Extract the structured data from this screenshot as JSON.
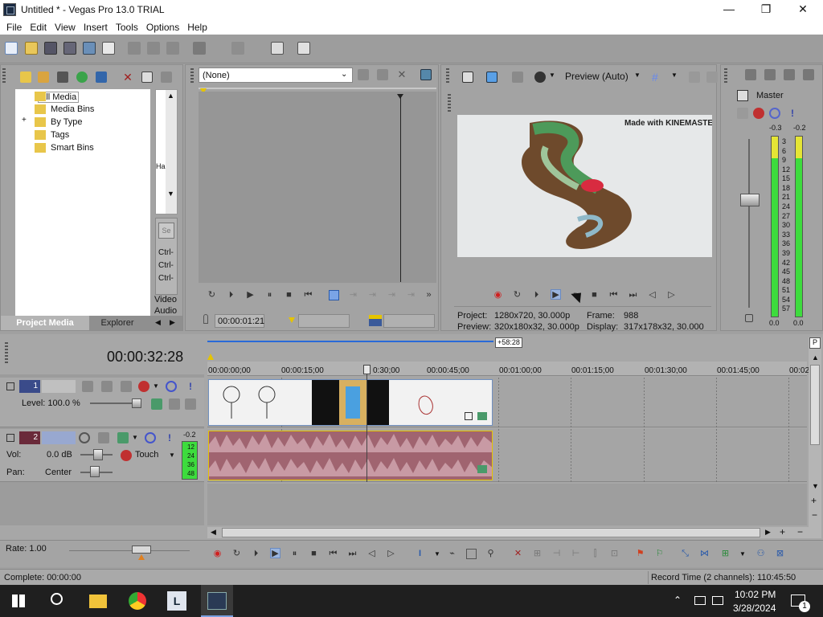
{
  "window": {
    "title": "Untitled * - Vegas Pro 13.0 TRIAL",
    "minimize": "—",
    "maximize": "❐",
    "close": "✕"
  },
  "menu": [
    "File",
    "Edit",
    "View",
    "Insert",
    "Tools",
    "Options",
    "Help"
  ],
  "media": {
    "tree": [
      "All Media",
      "Media Bins",
      "By Type",
      "Tags",
      "Smart Bins"
    ],
    "expander": "+",
    "side_labels": [
      "Ctrl-",
      "Ctrl-",
      "Ctrl-"
    ],
    "side_top": "Se",
    "ha": "Ha",
    "video_label": "Video",
    "audio_label": "Audio",
    "tabs": [
      "Project Media",
      "Explorer"
    ]
  },
  "trimmer": {
    "dropdown": "(None)",
    "timecode": "00:00:01:21"
  },
  "preview": {
    "mode": "Preview (Auto)",
    "watermark": "Made with KINEMASTER",
    "project_label": "Project:",
    "project_value": "1280x720, 30.000p",
    "frame_label": "Frame:",
    "frame_value": "988",
    "preview_label": "Preview:",
    "preview_value": "320x180x32, 30.000p",
    "display_label": "Display:",
    "display_value": "317x178x32, 30.000"
  },
  "master": {
    "label": "Master",
    "peak_left": "-0.3",
    "peak_right": "-0.2",
    "scale": [
      "3",
      "6",
      "9",
      "12",
      "15",
      "18",
      "21",
      "24",
      "27",
      "30",
      "33",
      "36",
      "39",
      "42",
      "45",
      "48",
      "51",
      "54",
      "57"
    ],
    "bottom_left": "0.0",
    "bottom_right": "0.0"
  },
  "timeline": {
    "time": "00:00:32:28",
    "region": "+58:28",
    "ruler": [
      "00:00:00;00",
      "00:00:15;00",
      "00:00:30;00",
      "00:00:45;00",
      "00:01:00;00",
      "00:01:15;00",
      "00:01:30;00",
      "00:01:45;00",
      "00:02"
    ],
    "ruler_cursor_label": "0:30;00"
  },
  "tracks": {
    "video": {
      "num": "1",
      "level": "Level: 100.0 %"
    },
    "audio": {
      "num": "2",
      "vol_label": "Vol:",
      "vol_value": "0.0 dB",
      "pan_label": "Pan:",
      "pan_value": "Center",
      "touch": "Touch",
      "meter_top": "-0.2",
      "meter": [
        "12",
        "24",
        "36",
        "48"
      ]
    }
  },
  "transport": {
    "rate": "Rate: 1.00"
  },
  "status": {
    "left": "Complete: 00:00:00",
    "right": "Record Time (2 channels): 110:45:50"
  },
  "taskbar": {
    "time": "10:02 PM",
    "date": "3/28/2024",
    "notif": "1"
  },
  "colors": {
    "accent": "#2a6ad8",
    "meter_green": "#3ddc3d",
    "meter_yellow": "#e5e535",
    "audio_clip": "#a06470",
    "track_label_blue": "#3a4b8a",
    "track_label_red": "#6a2a3a"
  }
}
